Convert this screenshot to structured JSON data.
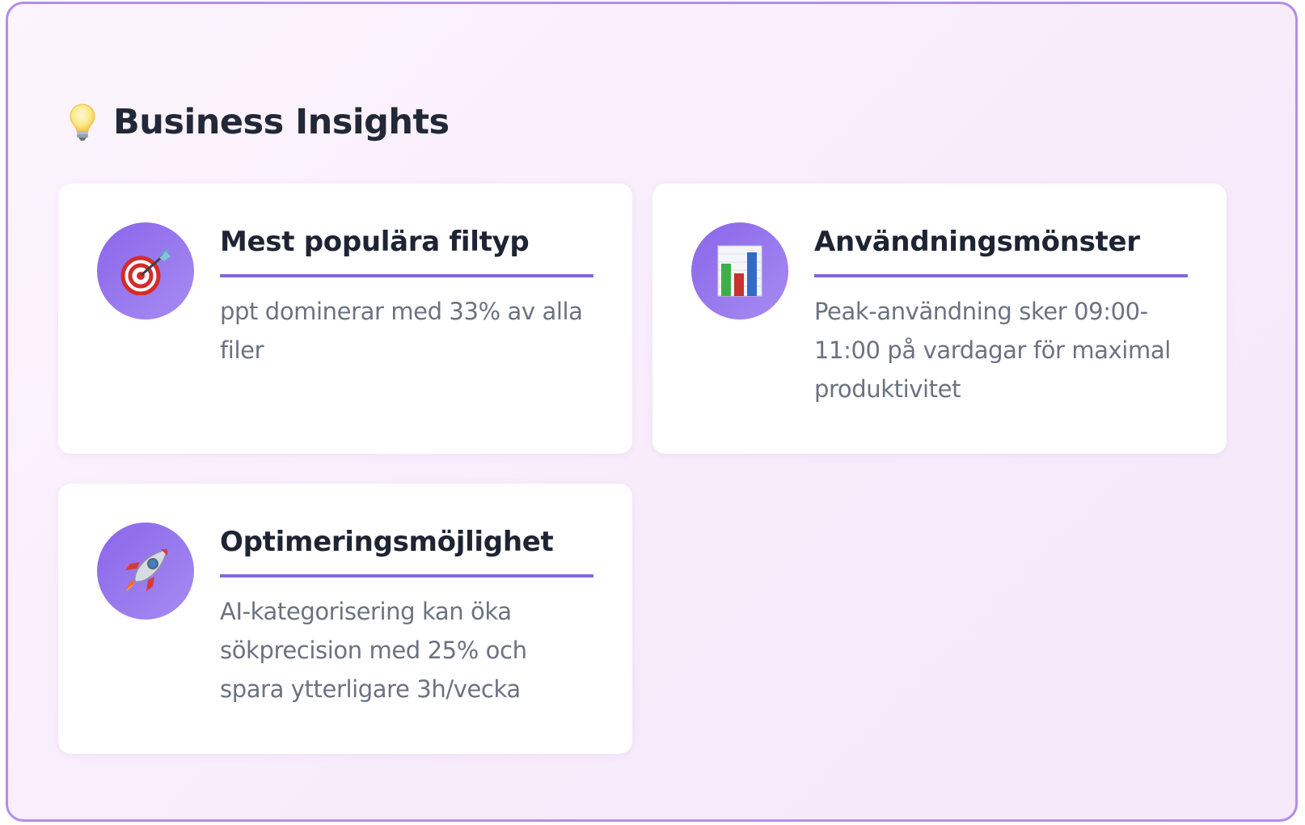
{
  "section": {
    "title": "Business Insights",
    "icon": "lightbulb-icon"
  },
  "cards": [
    {
      "icon": "target-dart-icon",
      "title": "Mest populära filtyp",
      "text": "ppt dominerar med 33% av alla filer"
    },
    {
      "icon": "bar-chart-icon",
      "title": "Användningsmönster",
      "text": "Peak-användning sker 09:00-11:00 på vardagar för maximal produktivitet"
    },
    {
      "icon": "rocket-icon",
      "title": "Optimeringsmöjlighet",
      "text": "AI-kategorisering kan öka sökprecision med 25% och spara ytterligare 3h/vecka"
    }
  ],
  "colors": {
    "accent": "#8666e0",
    "border": "#b48cec",
    "title": "#1e2433",
    "text": "#6b7280"
  }
}
